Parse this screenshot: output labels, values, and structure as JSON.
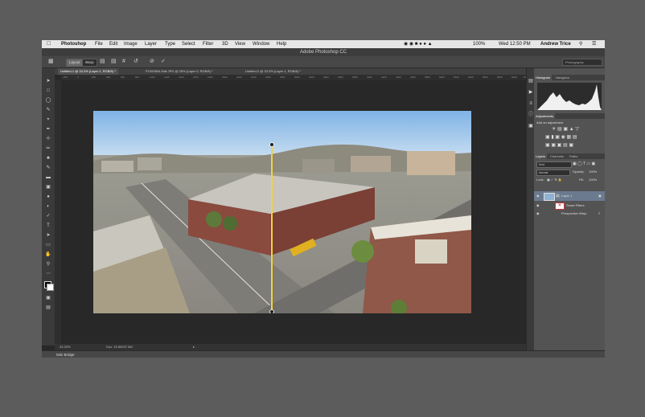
{
  "menubar": {
    "apple": "",
    "app": "Photoshop",
    "items": [
      "File",
      "Edit",
      "Image",
      "Layer",
      "Type",
      "Select",
      "Filter",
      "3D",
      "View",
      "Window",
      "Help"
    ],
    "battery": "100%",
    "clock": "Wed 12:50 PM",
    "user": "Andrew Trice"
  },
  "window": {
    "title": "Adobe Photoshop CC"
  },
  "options": {
    "layout": "Layout",
    "warp": "Warp",
    "workspace": "Photography"
  },
  "tabs": [
    "Untitled-1 @ 33.3% (Layer 1, RGB/8) *",
    "P1000604-Edit.JPG @ 25% (Layer 0, RGB/8) *",
    "Untitled-2 @ 33.3% (Layer 1, RGB/8) *"
  ],
  "ruler_ticks": [
    "-200",
    "0",
    "200",
    "400",
    "600",
    "800",
    "1000",
    "1200",
    "1400",
    "1600",
    "1800",
    "2000",
    "2200",
    "2400",
    "2600",
    "2800",
    "3000",
    "3200",
    "3400",
    "3600",
    "3800",
    "4000",
    "4200",
    "4400",
    "4600",
    "4800",
    "5000",
    "5200",
    "5400",
    "5600",
    "5800",
    "6000",
    "6200"
  ],
  "status": {
    "zoom": "33.33%",
    "doc": "Doc: 15.8M/37.6M"
  },
  "bottom": {
    "mini_bridge": "Mini Bridge"
  },
  "panels": {
    "histogram_tabs": [
      "Histogram",
      "Navigator"
    ],
    "adjustments_title": "Adjustments",
    "adjustments_hint": "Add an adjustment",
    "layers_tabs": [
      "Layers",
      "Channels",
      "Paths"
    ],
    "kind": "Kind",
    "blend_mode": "Normal",
    "opacity_label": "Opacity:",
    "opacity_value": "100%",
    "lock_label": "Lock:",
    "fill_label": "Fill:",
    "fill_value": "100%",
    "layers": [
      "Layer 1",
      "Smart Filters",
      "Perspective Warp"
    ]
  },
  "colors": {
    "accent": "#f4d23c",
    "histogram": "#f0f0f0"
  }
}
